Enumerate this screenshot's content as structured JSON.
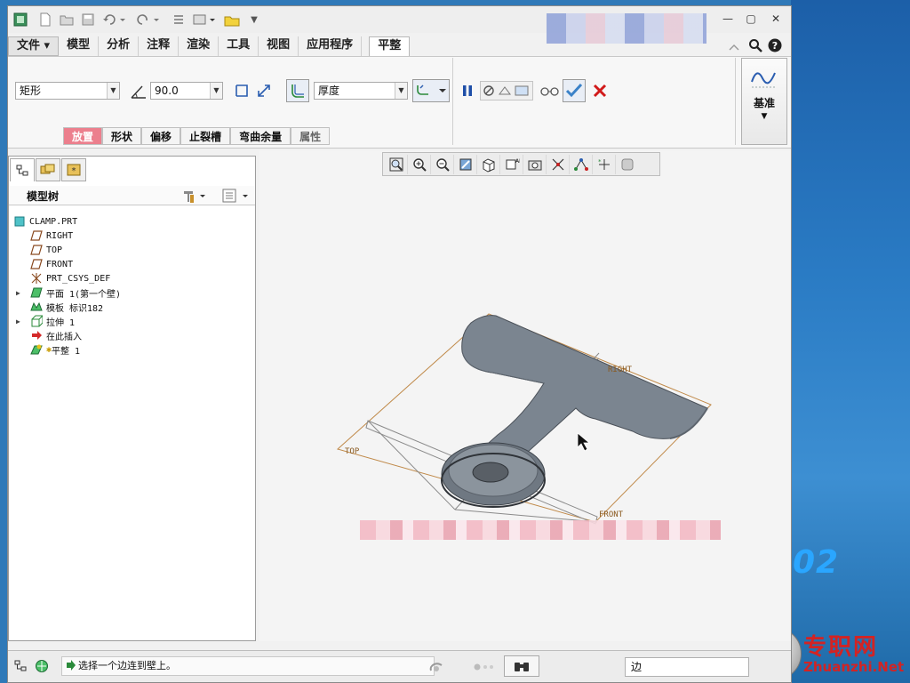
{
  "menu_tabs": [
    "文件",
    "模型",
    "分析",
    "注释",
    "渲染",
    "工具",
    "视图",
    "应用程序",
    "平整"
  ],
  "ribbon": {
    "shape_select": "矩形",
    "angle_value": "90.0",
    "thickness_select": "厚度"
  },
  "feature_tabs": [
    "放置",
    "形状",
    "偏移",
    "止裂槽",
    "弯曲余量",
    "属性"
  ],
  "datum": {
    "label": "基准"
  },
  "model_tree": {
    "title": "模型树",
    "items": [
      {
        "label": "CLAMP.PRT"
      },
      {
        "label": "RIGHT"
      },
      {
        "label": "TOP"
      },
      {
        "label": "FRONT"
      },
      {
        "label": "PRT_CSYS_DEF"
      },
      {
        "label": "平面 1(第一个壁)"
      },
      {
        "label": "模板 标识182"
      },
      {
        "label": "拉伸 1"
      },
      {
        "label": "在此插入"
      },
      {
        "label": "平整 1"
      }
    ]
  },
  "viewport": {
    "labels": {
      "right": "RIGHT",
      "top": "TOP",
      "front": "FRONT"
    }
  },
  "status": {
    "message": "选择一个边连到壁上。",
    "filter": "边"
  },
  "desktop": {
    "big_text": "02",
    "brand_cn": "专职网",
    "brand_en": "Zhuanzhi.Net"
  },
  "colors": {
    "accent_tab": "#ec7f8d",
    "datum_plane": "#c08a4a",
    "part": "#7b8590",
    "brand": "#d32323"
  }
}
